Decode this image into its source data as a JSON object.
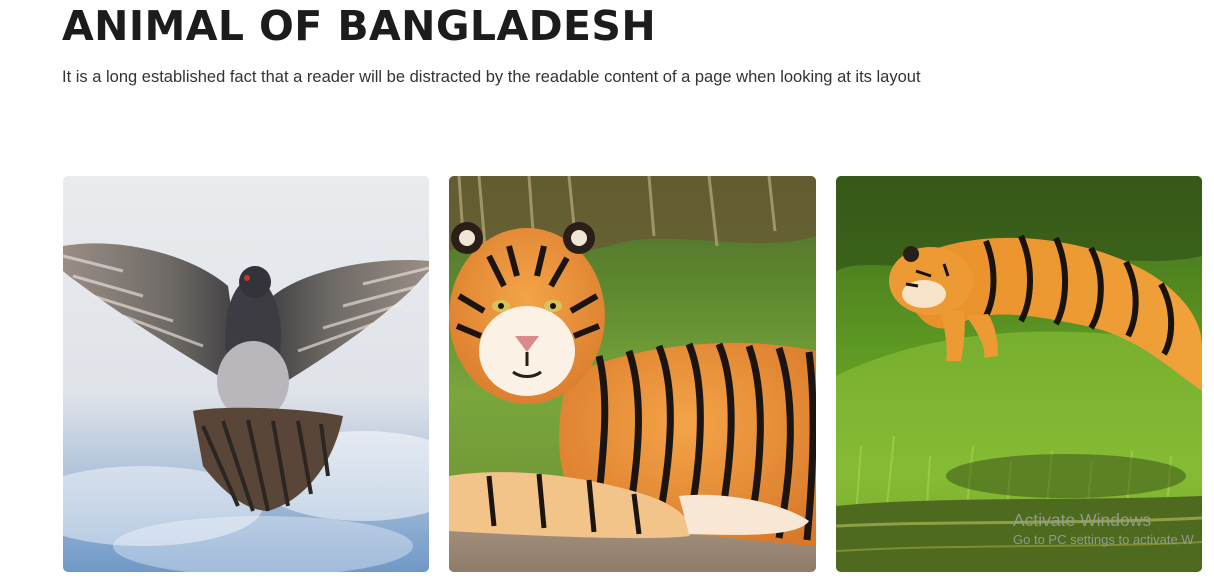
{
  "header": {
    "title": "ANIMAL OF BANGLADESH",
    "subtitle": "It is a long established fact that a reader will be distracted by the readable content of a page when looking at its layout"
  },
  "gallery": {
    "items": [
      {
        "subject": "pigeon-photo"
      },
      {
        "subject": "tiger-resting-photo"
      },
      {
        "subject": "tiger-leaping-photo"
      }
    ]
  },
  "watermark": {
    "title": "Activate Windows",
    "subtitle": "Go to PC settings to activate W"
  },
  "colors": {
    "title": "#1c1c1c",
    "text": "#333333",
    "tiger_orange": "#e08a2c",
    "grass_green": "#5f9a1e"
  }
}
